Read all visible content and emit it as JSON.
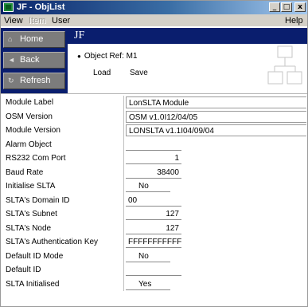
{
  "window": {
    "title": "JF - ObjList"
  },
  "title_buttons": {
    "minimize": "_",
    "maximize": "□",
    "close": "x"
  },
  "menu": [
    {
      "label": "View",
      "disabled": false
    },
    {
      "label": "Item",
      "disabled": true
    },
    {
      "label": "User",
      "disabled": false
    },
    {
      "label": "Help",
      "disabled": false
    }
  ],
  "nav": [
    {
      "label": "Home",
      "icon": "home-icon",
      "glyph": "⌂"
    },
    {
      "label": "Back",
      "icon": "back-arrow-icon",
      "glyph": "◄"
    },
    {
      "label": "Refresh",
      "icon": "refresh-icon",
      "glyph": "↻"
    }
  ],
  "header": {
    "title": "JF"
  },
  "object": {
    "ref_label": "Object Ref: M1",
    "load_label": "Load",
    "save_label": "Save"
  },
  "properties": [
    {
      "label": "Module Label",
      "value": "LonSLTA Module",
      "kind": "wide"
    },
    {
      "label": "OSM Version",
      "value": "OSM v1.0I12/04/05",
      "kind": "wide"
    },
    {
      "label": "Module Version",
      "value": "LONSLTA v1.1I04/09/04",
      "kind": "wide"
    },
    {
      "label": "Alarm Object",
      "value": "",
      "kind": "blank"
    },
    {
      "label": "RS232 Com Port",
      "value": "1",
      "kind": "num"
    },
    {
      "label": "Baud Rate",
      "value": "38400",
      "kind": "num"
    },
    {
      "label": "Initialise SLTA",
      "value": "No",
      "kind": "sel"
    },
    {
      "label": "SLTA's Domain ID",
      "value": "00",
      "kind": "txt"
    },
    {
      "label": "SLTA's Subnet",
      "value": "127",
      "kind": "num"
    },
    {
      "label": "SLTA's Node",
      "value": "127",
      "kind": "num"
    },
    {
      "label": "SLTA's Authentication Key",
      "value": "FFFFFFFFFFFF",
      "kind": "txt"
    },
    {
      "label": "Default ID Mode",
      "value": "No",
      "kind": "sel"
    },
    {
      "label": "Default ID",
      "value": "",
      "kind": "blank"
    },
    {
      "label": "SLTA Initialised",
      "value": "Yes",
      "kind": "sel"
    }
  ],
  "colors": {
    "nav_background": "#0a1e6e",
    "nav_button": "#7c7c7c",
    "title_gradient_start": "#0a246a",
    "title_gradient_end": "#a6caf0"
  }
}
